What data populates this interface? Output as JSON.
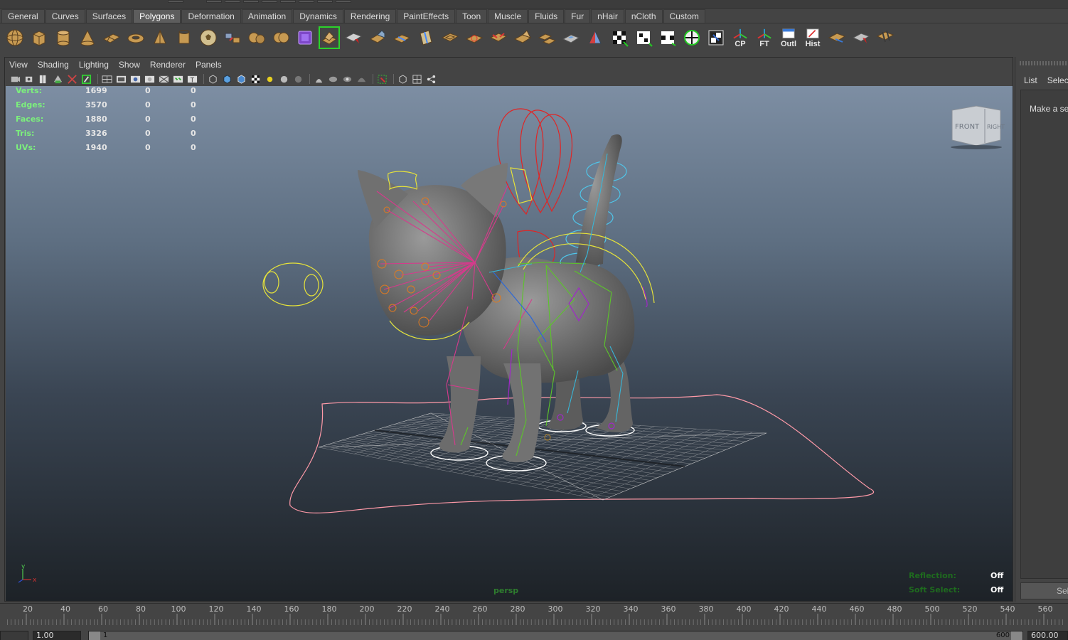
{
  "shelf_tabs": [
    "General",
    "Curves",
    "Surfaces",
    "Polygons",
    "Deformation",
    "Animation",
    "Dynamics",
    "Rendering",
    "PaintEffects",
    "Toon",
    "Muscle",
    "Fluids",
    "Fur",
    "nHair",
    "nCloth",
    "Custom"
  ],
  "shelf_active_tab": "Polygons",
  "shelf_labeled_buttons": {
    "cp": "CP",
    "ft": "FT",
    "outl": "Outl",
    "hist": "Hist"
  },
  "panel_menu": [
    "View",
    "Shading",
    "Lighting",
    "Show",
    "Renderer",
    "Panels"
  ],
  "hud": {
    "rows": [
      {
        "label": "Verts:",
        "v1": "1699",
        "v2": "0",
        "v3": "0"
      },
      {
        "label": "Edges:",
        "v1": "3570",
        "v2": "0",
        "v3": "0"
      },
      {
        "label": "Faces:",
        "v1": "1880",
        "v2": "0",
        "v3": "0"
      },
      {
        "label": "Tris:",
        "v1": "3326",
        "v2": "0",
        "v3": "0"
      },
      {
        "label": "UVs:",
        "v1": "1940",
        "v2": "0",
        "v3": "0"
      }
    ],
    "camera": "persp",
    "reflection_label": "Reflection:",
    "reflection_value": "Off",
    "soft_select_label": "Soft Select:",
    "soft_select_value": "Off"
  },
  "viewcube": {
    "front": "FRONT",
    "right": "RIGHT"
  },
  "axis": {
    "x": "x",
    "y": "y"
  },
  "side_panel": {
    "tabs": [
      "List",
      "Selected"
    ],
    "message": "Make a selection",
    "button": "Select"
  },
  "timeline": {
    "ticks": [
      "20",
      "40",
      "60",
      "80",
      "100",
      "120",
      "140",
      "160",
      "180",
      "200",
      "220",
      "240",
      "260",
      "280",
      "300",
      "320",
      "340",
      "360",
      "380",
      "400",
      "420",
      "440",
      "460",
      "480",
      "500",
      "520",
      "540",
      "560"
    ]
  },
  "range": {
    "start_field": "1.00",
    "range_start": "1",
    "range_end": "600",
    "end_field": "600.00"
  },
  "colors": {
    "hud_label": "#7cf07c",
    "selection_outline": "#2bd32b",
    "skeleton_pink": "#d63a8c",
    "skeleton_green": "#5cc52a",
    "skeleton_cyan": "#38b6d8",
    "control_yellow": "#e6e23a",
    "control_red": "#e02525",
    "ground_curve": "#ff9aa8"
  }
}
